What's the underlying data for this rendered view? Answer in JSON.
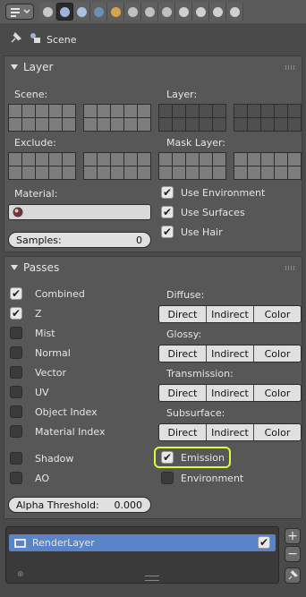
{
  "header": {
    "editor_icon": "properties-editor-icon",
    "context_tabs": [
      {
        "icon": "render-icon",
        "color": "#c9c9c9"
      },
      {
        "icon": "render-layers-icon",
        "color": "#9fb3d8",
        "active": true
      },
      {
        "icon": "scene-icon",
        "color": "#aac1e0"
      },
      {
        "icon": "world-icon",
        "color": "#6b8fb0"
      },
      {
        "icon": "object-icon",
        "color": "#d9a34b"
      },
      {
        "icon": "constraints-icon",
        "color": "#c0c0c0"
      },
      {
        "icon": "modifiers-icon",
        "color": "#c0c0c0"
      },
      {
        "icon": "data-icon",
        "color": "#c0c0c0"
      },
      {
        "icon": "material-icon",
        "color": "#d0d0d0"
      },
      {
        "icon": "texture-icon",
        "color": "#d0d0d0"
      },
      {
        "icon": "particles-icon",
        "color": "#d0d0d0"
      },
      {
        "icon": "physics-icon",
        "color": "#d0d0d0"
      }
    ]
  },
  "breadcrumb": {
    "label": "Scene"
  },
  "layer_panel": {
    "title": "Layer",
    "scene_label": "Scene:",
    "layer_label": "Layer:",
    "exclude_label": "Exclude:",
    "mask_label": "Mask Layer:",
    "material_label": "Material:",
    "samples_label": "Samples:",
    "samples_value": "0",
    "use_environment": "Use Environment",
    "use_surfaces": "Use Surfaces",
    "use_hair": "Use Hair"
  },
  "passes_panel": {
    "title": "Passes",
    "left_passes": [
      {
        "label": "Combined",
        "checked": true
      },
      {
        "label": "Z",
        "checked": true
      },
      {
        "label": "Mist",
        "checked": false
      },
      {
        "label": "Normal",
        "checked": false
      },
      {
        "label": "Vector",
        "checked": false
      },
      {
        "label": "UV",
        "checked": false
      },
      {
        "label": "Object Index",
        "checked": false
      },
      {
        "label": "Material Index",
        "checked": false
      }
    ],
    "groups": [
      {
        "label": "Diffuse:",
        "buttons": [
          "Direct",
          "Indirect",
          "Color"
        ]
      },
      {
        "label": "Glossy:",
        "buttons": [
          "Direct",
          "Indirect",
          "Color"
        ]
      },
      {
        "label": "Transmission:",
        "buttons": [
          "Direct",
          "Indirect",
          "Color"
        ]
      },
      {
        "label": "Subsurface:",
        "buttons": [
          "Direct",
          "Indirect",
          "Color"
        ]
      }
    ],
    "shadow": "Shadow",
    "ao": "AO",
    "emission": "Emission",
    "environment": "Environment",
    "alpha_label": "Alpha Threshold:",
    "alpha_value": "0.000"
  },
  "render_layers": {
    "item_label": "RenderLayer",
    "add_label": "+",
    "remove_label": "−"
  },
  "colors": {
    "highlight": "#d4ff3a",
    "selection": "#5a84c8"
  }
}
